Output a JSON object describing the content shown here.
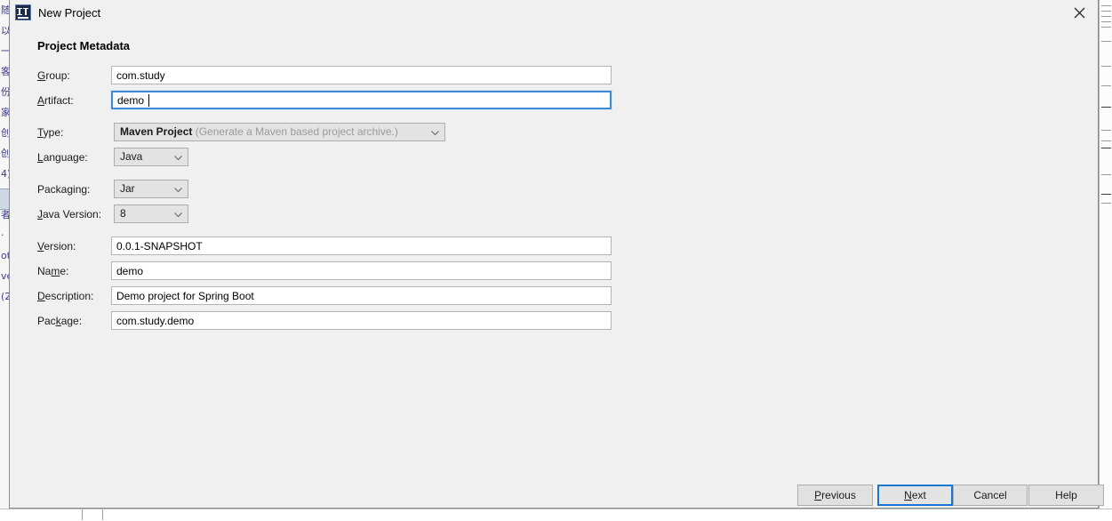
{
  "background": {
    "left_strip_text": "随以一客份家 创创 4)ot者 otve (2",
    "selection_color": "#cfd8e6"
  },
  "dialog": {
    "title": "New Project",
    "title_icon": "intellij-idea-icon",
    "close_icon": "close-icon",
    "section_title": "Project Metadata",
    "accent_color": "#1977d4",
    "fields": [
      {
        "id": "group",
        "label": "Group:",
        "mnemonic": "G",
        "type": "text",
        "value": "com.study",
        "focused": false
      },
      {
        "id": "artifact",
        "label": "Artifact:",
        "mnemonic": "A",
        "type": "text",
        "value": "demo",
        "focused": true
      },
      {
        "id": "type",
        "label": "Type:",
        "mnemonic": "T",
        "type": "combo",
        "value": "Maven Project",
        "hint": "(Generate a Maven based project archive.)",
        "focused": false
      },
      {
        "id": "language",
        "label": "Language:",
        "mnemonic": "L",
        "type": "combo",
        "value": "Java",
        "hint": "",
        "focused": false
      },
      {
        "id": "packaging",
        "label": "Packaging:",
        "mnemonic": "g",
        "type": "combo",
        "value": "Jar",
        "hint": "",
        "focused": false
      },
      {
        "id": "java_version",
        "label": "Java Version:",
        "mnemonic": "J",
        "type": "combo",
        "value": "8",
        "hint": "",
        "focused": false
      },
      {
        "id": "version",
        "label": "Version:",
        "mnemonic": "V",
        "type": "text",
        "value": "0.0.1-SNAPSHOT",
        "focused": false
      },
      {
        "id": "name",
        "label": "Name:",
        "mnemonic": "m",
        "type": "text",
        "value": "demo",
        "focused": false
      },
      {
        "id": "description",
        "label": "Description:",
        "mnemonic": "D",
        "type": "text",
        "value": "Demo project for Spring Boot",
        "focused": false
      },
      {
        "id": "package",
        "label": "Package:",
        "mnemonic": "k",
        "type": "text",
        "value": "com.study.demo",
        "focused": false
      }
    ],
    "buttons": [
      {
        "id": "previous",
        "label": "Previous",
        "primary": false
      },
      {
        "id": "next",
        "label": "Next",
        "primary": true
      },
      {
        "id": "cancel",
        "label": "Cancel",
        "primary": false
      },
      {
        "id": "help",
        "label": "Help",
        "primary": false
      }
    ]
  },
  "labels": {
    "group_pre": "",
    "group_mn": "G",
    "group_post": "roup:",
    "artifact_pre": "",
    "artifact_mn": "A",
    "artifact_post": "rtifact:",
    "type_pre": "",
    "type_mn": "T",
    "type_post": "ype:",
    "language_pre": "",
    "language_mn": "L",
    "language_post": "anguage:",
    "packaging_pre": "Packa",
    "packaging_mn": "g",
    "packaging_post": "ing:",
    "javaversion_pre": "",
    "javaversion_mn": "J",
    "javaversion_post": "ava Version:",
    "version_pre": "",
    "version_mn": "V",
    "version_post": "ersion:",
    "name_pre": "Na",
    "name_mn": "m",
    "name_post": "e:",
    "description_pre": "",
    "description_mn": "D",
    "description_post": "escription:",
    "package_pre": "Pac",
    "package_mn": "k",
    "package_post": "age:",
    "previous_pre": "",
    "previous_mn": "P",
    "previous_post": "revious",
    "next_pre": "",
    "next_mn": "N",
    "next_post": "ext",
    "cancel_full": "Cancel",
    "help_full": "Help"
  },
  "combo_values": {
    "type_main": "Maven Project",
    "type_hint": "(Generate a Maven based project archive.)",
    "language": "Java",
    "packaging": "Jar",
    "java_version": "8"
  }
}
